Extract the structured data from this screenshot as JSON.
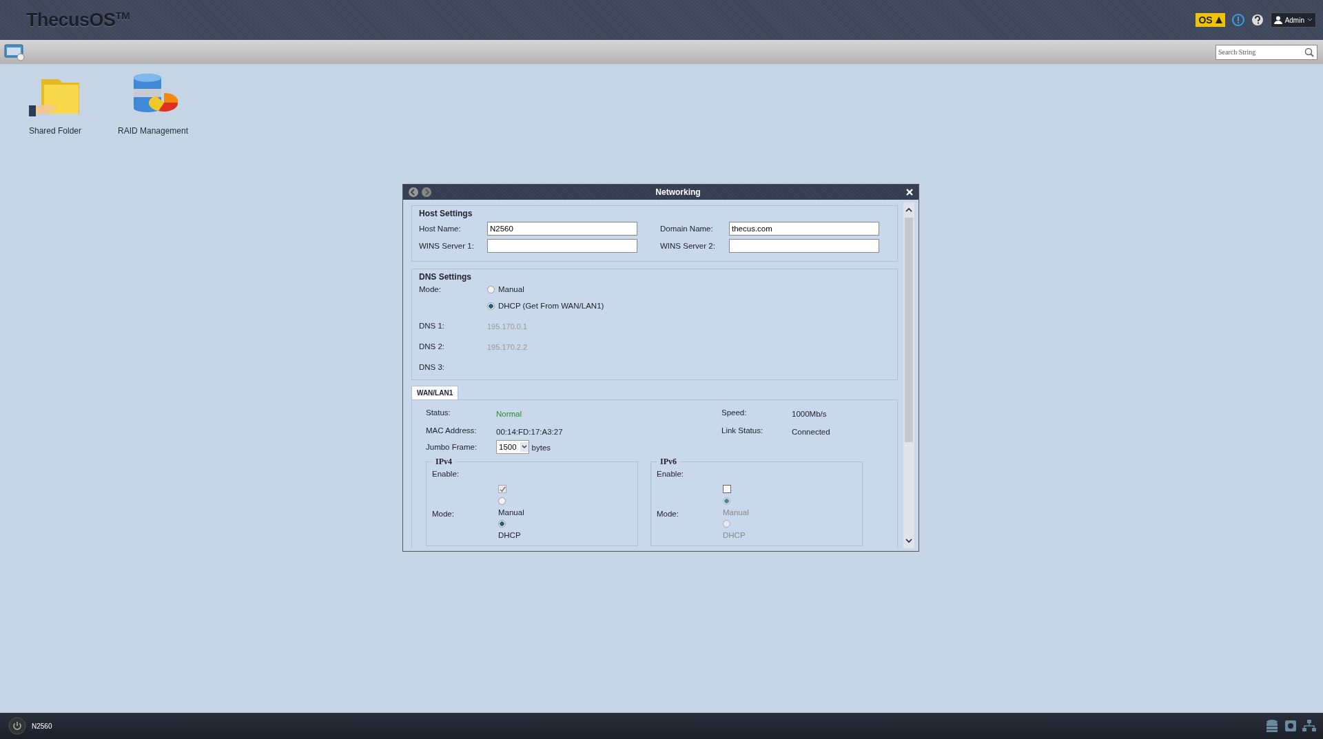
{
  "header": {
    "logo": "ThecusOS",
    "logo_mark": "TM",
    "os_badge": "OS",
    "user": "Admin"
  },
  "toolbar": {
    "search_placeholder": "Search String"
  },
  "desktop_icons": [
    {
      "label": "Shared Folder",
      "kind": "folder"
    },
    {
      "label": "RAID Management",
      "kind": "raid"
    }
  ],
  "window": {
    "title": "Networking",
    "host_settings": {
      "title": "Host Settings",
      "fields": [
        {
          "label": "Host Name:",
          "value": "N2560"
        },
        {
          "label": "Domain Name:",
          "value": "thecus.com"
        },
        {
          "label": "WINS Server 1:"
        },
        {
          "label": "WINS Server 2:"
        }
      ]
    },
    "dns_settings": {
      "title": "DNS Settings",
      "mode_label": "Mode:",
      "modes": [
        {
          "label": "Manual",
          "selected": false
        },
        {
          "label": "DHCP (Get From WAN/LAN1)",
          "selected": true
        }
      ],
      "servers": [
        {
          "label": "DNS 1:",
          "value": "195.170.0.1"
        },
        {
          "label": "DNS 2:",
          "value": "195.170.2.2"
        },
        {
          "label": "DNS 3:"
        }
      ]
    },
    "tabs": [
      {
        "label": "WAN/LAN1",
        "selected": true
      }
    ],
    "info": [
      {
        "label": "Status:",
        "value": "Normal",
        "kind": "ok"
      },
      {
        "label": "Speed:",
        "value": "1000Mb/s",
        "kind": "plain"
      },
      {
        "label": "MAC Address:",
        "value": "00:14:FD:17:A3:27",
        "kind": "plain"
      },
      {
        "label": "Link Status:",
        "value": "Connected",
        "kind": "plain"
      }
    ],
    "jumbo": {
      "label": "Jumbo Frame:",
      "value": "1500",
      "unit": "bytes"
    },
    "ip_groups": [
      {
        "title": "IPv4",
        "enable_label": "Enable:",
        "enabled": true,
        "enable_disabled": true,
        "mode_label": "Mode:",
        "modes_disabled": false,
        "modes": [
          {
            "label": "Manual",
            "selected": false
          },
          {
            "label": "DHCP",
            "selected": true
          }
        ]
      },
      {
        "title": "IPv6",
        "enable_label": "Enable:",
        "enabled": false,
        "enable_disabled": false,
        "mode_label": "Mode:",
        "modes_disabled": true,
        "modes": [
          {
            "label": "Manual",
            "selected": true
          },
          {
            "label": "DHCP",
            "selected": false
          }
        ]
      }
    ]
  },
  "taskbar": {
    "device": "N2560"
  }
}
